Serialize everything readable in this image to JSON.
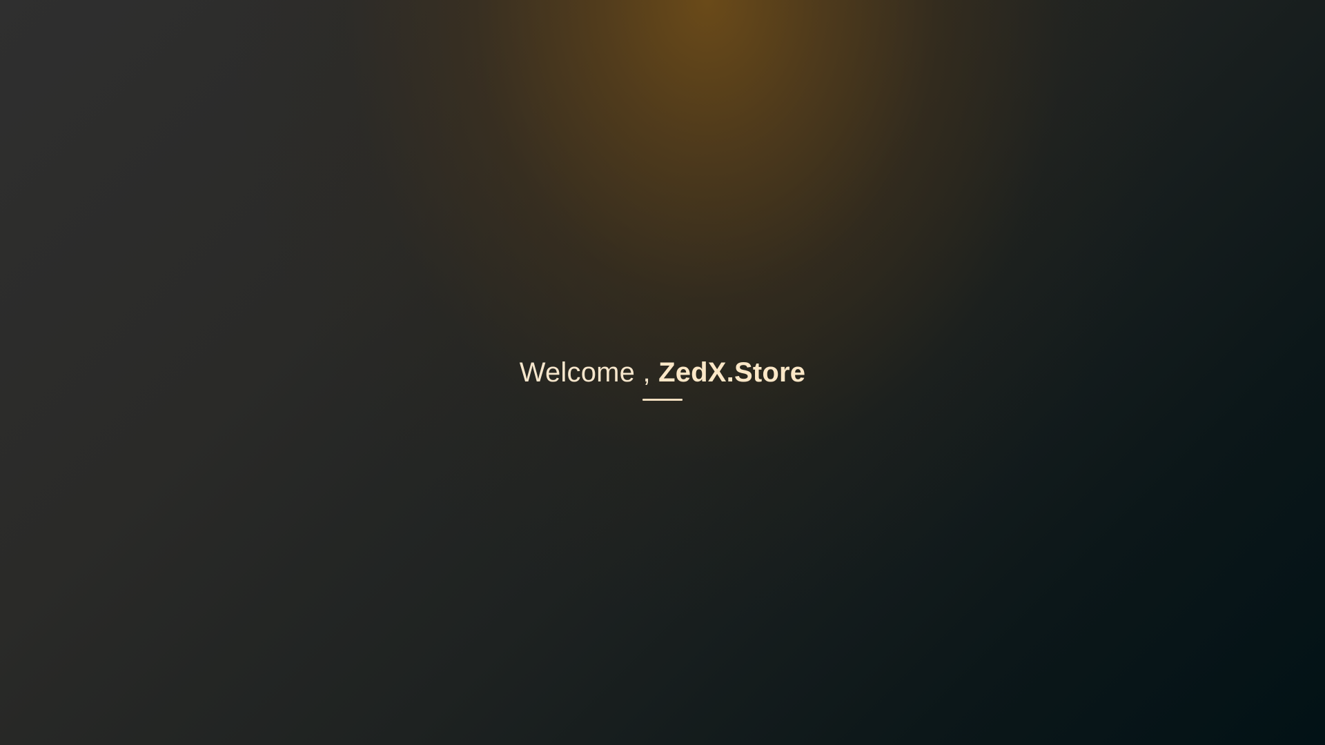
{
  "welcome": {
    "greeting": "Welcome , ",
    "brand": "ZedX.Store"
  },
  "colors": {
    "text": "#f6e6cc",
    "accent_glow": "#6e4c18",
    "background_dark": "#021216"
  }
}
